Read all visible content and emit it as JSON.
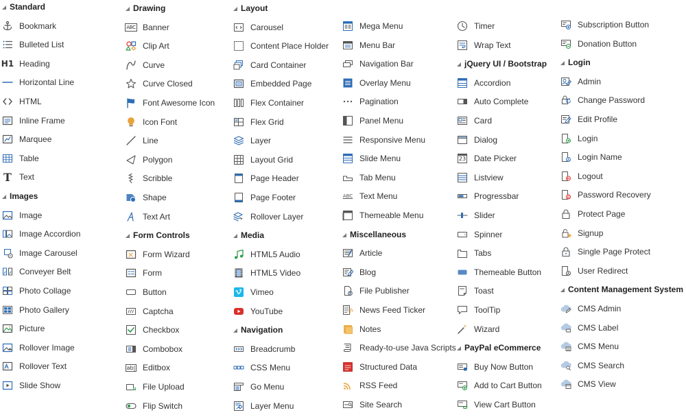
{
  "columns": [
    {
      "groups": [
        {
          "title": "Standard",
          "items": [
            {
              "label": "Bookmark",
              "icon": "anchor-icon"
            },
            {
              "label": "Bulleted List",
              "icon": "bulleted-list-icon"
            },
            {
              "label": "Heading",
              "icon": "heading-icon"
            },
            {
              "label": "Horizontal Line",
              "icon": "horizontal-line-icon"
            },
            {
              "label": "HTML",
              "icon": "html-icon"
            },
            {
              "label": "Inline Frame",
              "icon": "inline-frame-icon"
            },
            {
              "label": "Marquee",
              "icon": "marquee-icon"
            },
            {
              "label": "Table",
              "icon": "table-icon"
            },
            {
              "label": "Text",
              "icon": "text-icon"
            }
          ]
        },
        {
          "title": "Images",
          "items": [
            {
              "label": "Image",
              "icon": "image-icon"
            },
            {
              "label": "Image Accordion",
              "icon": "image-accordion-icon"
            },
            {
              "label": "Image Carousel",
              "icon": "image-carousel-icon"
            },
            {
              "label": "Conveyer Belt",
              "icon": "conveyer-belt-icon"
            },
            {
              "label": "Photo Collage",
              "icon": "photo-collage-icon"
            },
            {
              "label": "Photo Gallery",
              "icon": "photo-gallery-icon"
            },
            {
              "label": "Picture",
              "icon": "picture-icon"
            },
            {
              "label": "Rollover Image",
              "icon": "rollover-image-icon"
            },
            {
              "label": "Rollover Text",
              "icon": "rollover-text-icon"
            },
            {
              "label": "Slide Show",
              "icon": "slide-show-icon"
            }
          ]
        }
      ]
    },
    {
      "groups": [
        {
          "title": "Drawing",
          "items": [
            {
              "label": "Banner",
              "icon": "banner-icon"
            },
            {
              "label": "Clip Art",
              "icon": "clip-art-icon"
            },
            {
              "label": "Curve",
              "icon": "curve-icon"
            },
            {
              "label": "Curve Closed",
              "icon": "curve-closed-icon"
            },
            {
              "label": "Font Awesome Icon",
              "icon": "flag-icon"
            },
            {
              "label": "Icon Font",
              "icon": "lightbulb-icon"
            },
            {
              "label": "Line",
              "icon": "line-icon"
            },
            {
              "label": "Polygon",
              "icon": "polygon-icon"
            },
            {
              "label": "Scribble",
              "icon": "scribble-icon"
            },
            {
              "label": "Shape",
              "icon": "shape-icon"
            },
            {
              "label": "Text Art",
              "icon": "text-art-icon"
            }
          ]
        },
        {
          "title": "Form Controls",
          "items": [
            {
              "label": "Form Wizard",
              "icon": "form-wizard-icon"
            },
            {
              "label": "Form",
              "icon": "form-icon"
            },
            {
              "label": "Button",
              "icon": "button-icon"
            },
            {
              "label": "Captcha",
              "icon": "captcha-icon"
            },
            {
              "label": "Checkbox",
              "icon": "checkbox-icon"
            },
            {
              "label": "Combobox",
              "icon": "combobox-icon"
            },
            {
              "label": "Editbox",
              "icon": "editbox-icon"
            },
            {
              "label": "File Upload",
              "icon": "file-upload-icon"
            },
            {
              "label": "Flip Switch",
              "icon": "flip-switch-icon"
            }
          ]
        }
      ]
    },
    {
      "groups": [
        {
          "title": "Layout",
          "items": [
            {
              "label": "Carousel",
              "icon": "carousel-icon"
            },
            {
              "label": "Content Place Holder",
              "icon": "placeholder-icon"
            },
            {
              "label": "Card Container",
              "icon": "card-container-icon"
            },
            {
              "label": "Embedded Page",
              "icon": "embedded-page-icon"
            },
            {
              "label": "Flex Container",
              "icon": "flex-container-icon"
            },
            {
              "label": "Flex Grid",
              "icon": "flex-grid-icon"
            },
            {
              "label": "Layer",
              "icon": "layer-icon"
            },
            {
              "label": "Layout Grid",
              "icon": "layout-grid-icon"
            },
            {
              "label": "Page Header",
              "icon": "page-header-icon"
            },
            {
              "label": "Page Footer",
              "icon": "page-footer-icon"
            },
            {
              "label": "Rollover Layer",
              "icon": "rollover-layer-icon"
            }
          ]
        },
        {
          "title": "Media",
          "items": [
            {
              "label": "HTML5 Audio",
              "icon": "music-note-icon"
            },
            {
              "label": "HTML5 Video",
              "icon": "film-icon"
            },
            {
              "label": "Vimeo",
              "icon": "vimeo-icon"
            },
            {
              "label": "YouTube",
              "icon": "youtube-icon"
            }
          ]
        },
        {
          "title": "Navigation",
          "items": [
            {
              "label": "Breadcrumb",
              "icon": "breadcrumb-icon"
            },
            {
              "label": "CSS Menu",
              "icon": "css-menu-icon"
            },
            {
              "label": "Go Menu",
              "icon": "go-menu-icon"
            },
            {
              "label": "Layer Menu",
              "icon": "layer-menu-icon"
            }
          ]
        }
      ]
    },
    {
      "groups": [
        {
          "title": "",
          "items": [
            {
              "label": "Mega Menu",
              "icon": "mega-menu-icon"
            },
            {
              "label": "Menu Bar",
              "icon": "menu-bar-icon"
            },
            {
              "label": "Navigation Bar",
              "icon": "navigation-bar-icon"
            },
            {
              "label": "Overlay Menu",
              "icon": "overlay-menu-icon"
            },
            {
              "label": "Pagination",
              "icon": "pagination-icon"
            },
            {
              "label": "Panel Menu",
              "icon": "panel-menu-icon"
            },
            {
              "label": "Responsive Menu",
              "icon": "hamburger-icon"
            },
            {
              "label": "Slide Menu",
              "icon": "slide-menu-icon"
            },
            {
              "label": "Tab Menu",
              "icon": "tab-menu-icon"
            },
            {
              "label": "Text Menu",
              "icon": "text-menu-icon"
            },
            {
              "label": "Themeable Menu",
              "icon": "themeable-menu-icon"
            }
          ]
        },
        {
          "title": "Miscellaneous",
          "items": [
            {
              "label": "Article",
              "icon": "article-icon"
            },
            {
              "label": "Blog",
              "icon": "blog-icon"
            },
            {
              "label": "File Publisher",
              "icon": "file-publisher-icon"
            },
            {
              "label": "News Feed Ticker",
              "icon": "news-feed-icon"
            },
            {
              "label": "Notes",
              "icon": "notes-icon"
            },
            {
              "label": "Ready-to-use Java Scripts",
              "icon": "script-icon"
            },
            {
              "label": "Structured Data",
              "icon": "structured-data-icon"
            },
            {
              "label": "RSS Feed",
              "icon": "rss-icon"
            },
            {
              "label": "Site Search",
              "icon": "site-search-icon"
            }
          ]
        }
      ]
    },
    {
      "groups": [
        {
          "title": "",
          "items": [
            {
              "label": "Timer",
              "icon": "clock-icon"
            },
            {
              "label": "Wrap Text",
              "icon": "wrap-text-icon"
            }
          ]
        },
        {
          "title": "jQuery UI / Bootstrap",
          "items": [
            {
              "label": "Accordion",
              "icon": "accordion-icon"
            },
            {
              "label": "Auto Complete",
              "icon": "auto-complete-icon"
            },
            {
              "label": "Card",
              "icon": "card-icon"
            },
            {
              "label": "Dialog",
              "icon": "dialog-icon"
            },
            {
              "label": "Date Picker",
              "icon": "calendar-icon"
            },
            {
              "label": "Listview",
              "icon": "listview-icon"
            },
            {
              "label": "Progressbar",
              "icon": "progressbar-icon"
            },
            {
              "label": "Slider",
              "icon": "slider-icon"
            },
            {
              "label": "Spinner",
              "icon": "spinner-icon"
            },
            {
              "label": "Tabs",
              "icon": "tabs-icon"
            },
            {
              "label": "Themeable Button",
              "icon": "themeable-button-icon"
            },
            {
              "label": "Toast",
              "icon": "toast-icon"
            },
            {
              "label": "ToolTip",
              "icon": "tooltip-icon"
            },
            {
              "label": "Wizard",
              "icon": "magic-wand-icon"
            }
          ]
        },
        {
          "title": "PayPal eCommerce",
          "items": [
            {
              "label": "Buy Now Button",
              "icon": "buy-now-icon"
            },
            {
              "label": "Add to Cart Button",
              "icon": "add-to-cart-icon"
            },
            {
              "label": "View Cart Button",
              "icon": "view-cart-icon"
            }
          ]
        }
      ]
    },
    {
      "groups": [
        {
          "title": "",
          "items": [
            {
              "label": "Subscription Button",
              "icon": "subscription-icon"
            },
            {
              "label": "Donation Button",
              "icon": "donation-icon"
            }
          ]
        },
        {
          "title": "Login",
          "items": [
            {
              "label": "Admin",
              "icon": "admin-icon"
            },
            {
              "label": "Change Password",
              "icon": "change-password-icon"
            },
            {
              "label": "Edit Profile",
              "icon": "edit-profile-icon"
            },
            {
              "label": "Login",
              "icon": "login-icon"
            },
            {
              "label": "Login Name",
              "icon": "login-name-icon"
            },
            {
              "label": "Logout",
              "icon": "logout-icon"
            },
            {
              "label": "Password Recovery",
              "icon": "password-recovery-icon"
            },
            {
              "label": "Protect Page",
              "icon": "lock-icon"
            },
            {
              "label": "Signup",
              "icon": "signup-icon"
            },
            {
              "label": "Single Page Protect",
              "icon": "single-page-protect-icon"
            },
            {
              "label": "User Redirect",
              "icon": "user-redirect-icon"
            }
          ]
        },
        {
          "title": "Content Management System",
          "items": [
            {
              "label": "CMS Admin",
              "icon": "cms-admin-icon"
            },
            {
              "label": "CMS Label",
              "icon": "cms-label-icon"
            },
            {
              "label": "CMS Menu",
              "icon": "cms-menu-icon"
            },
            {
              "label": "CMS Search",
              "icon": "cms-search-icon"
            },
            {
              "label": "CMS View",
              "icon": "cms-view-icon"
            }
          ]
        }
      ]
    }
  ],
  "colors": {
    "icon_blue": "#2f6db5",
    "icon_gray": "#555555",
    "header_triangle": "#7a7a7a",
    "text": "#333333",
    "accent_orange": "#e8a33c",
    "accent_green": "#2e9a4a",
    "accent_red": "#d9302c",
    "vimeo_blue": "#1ab7ea"
  }
}
